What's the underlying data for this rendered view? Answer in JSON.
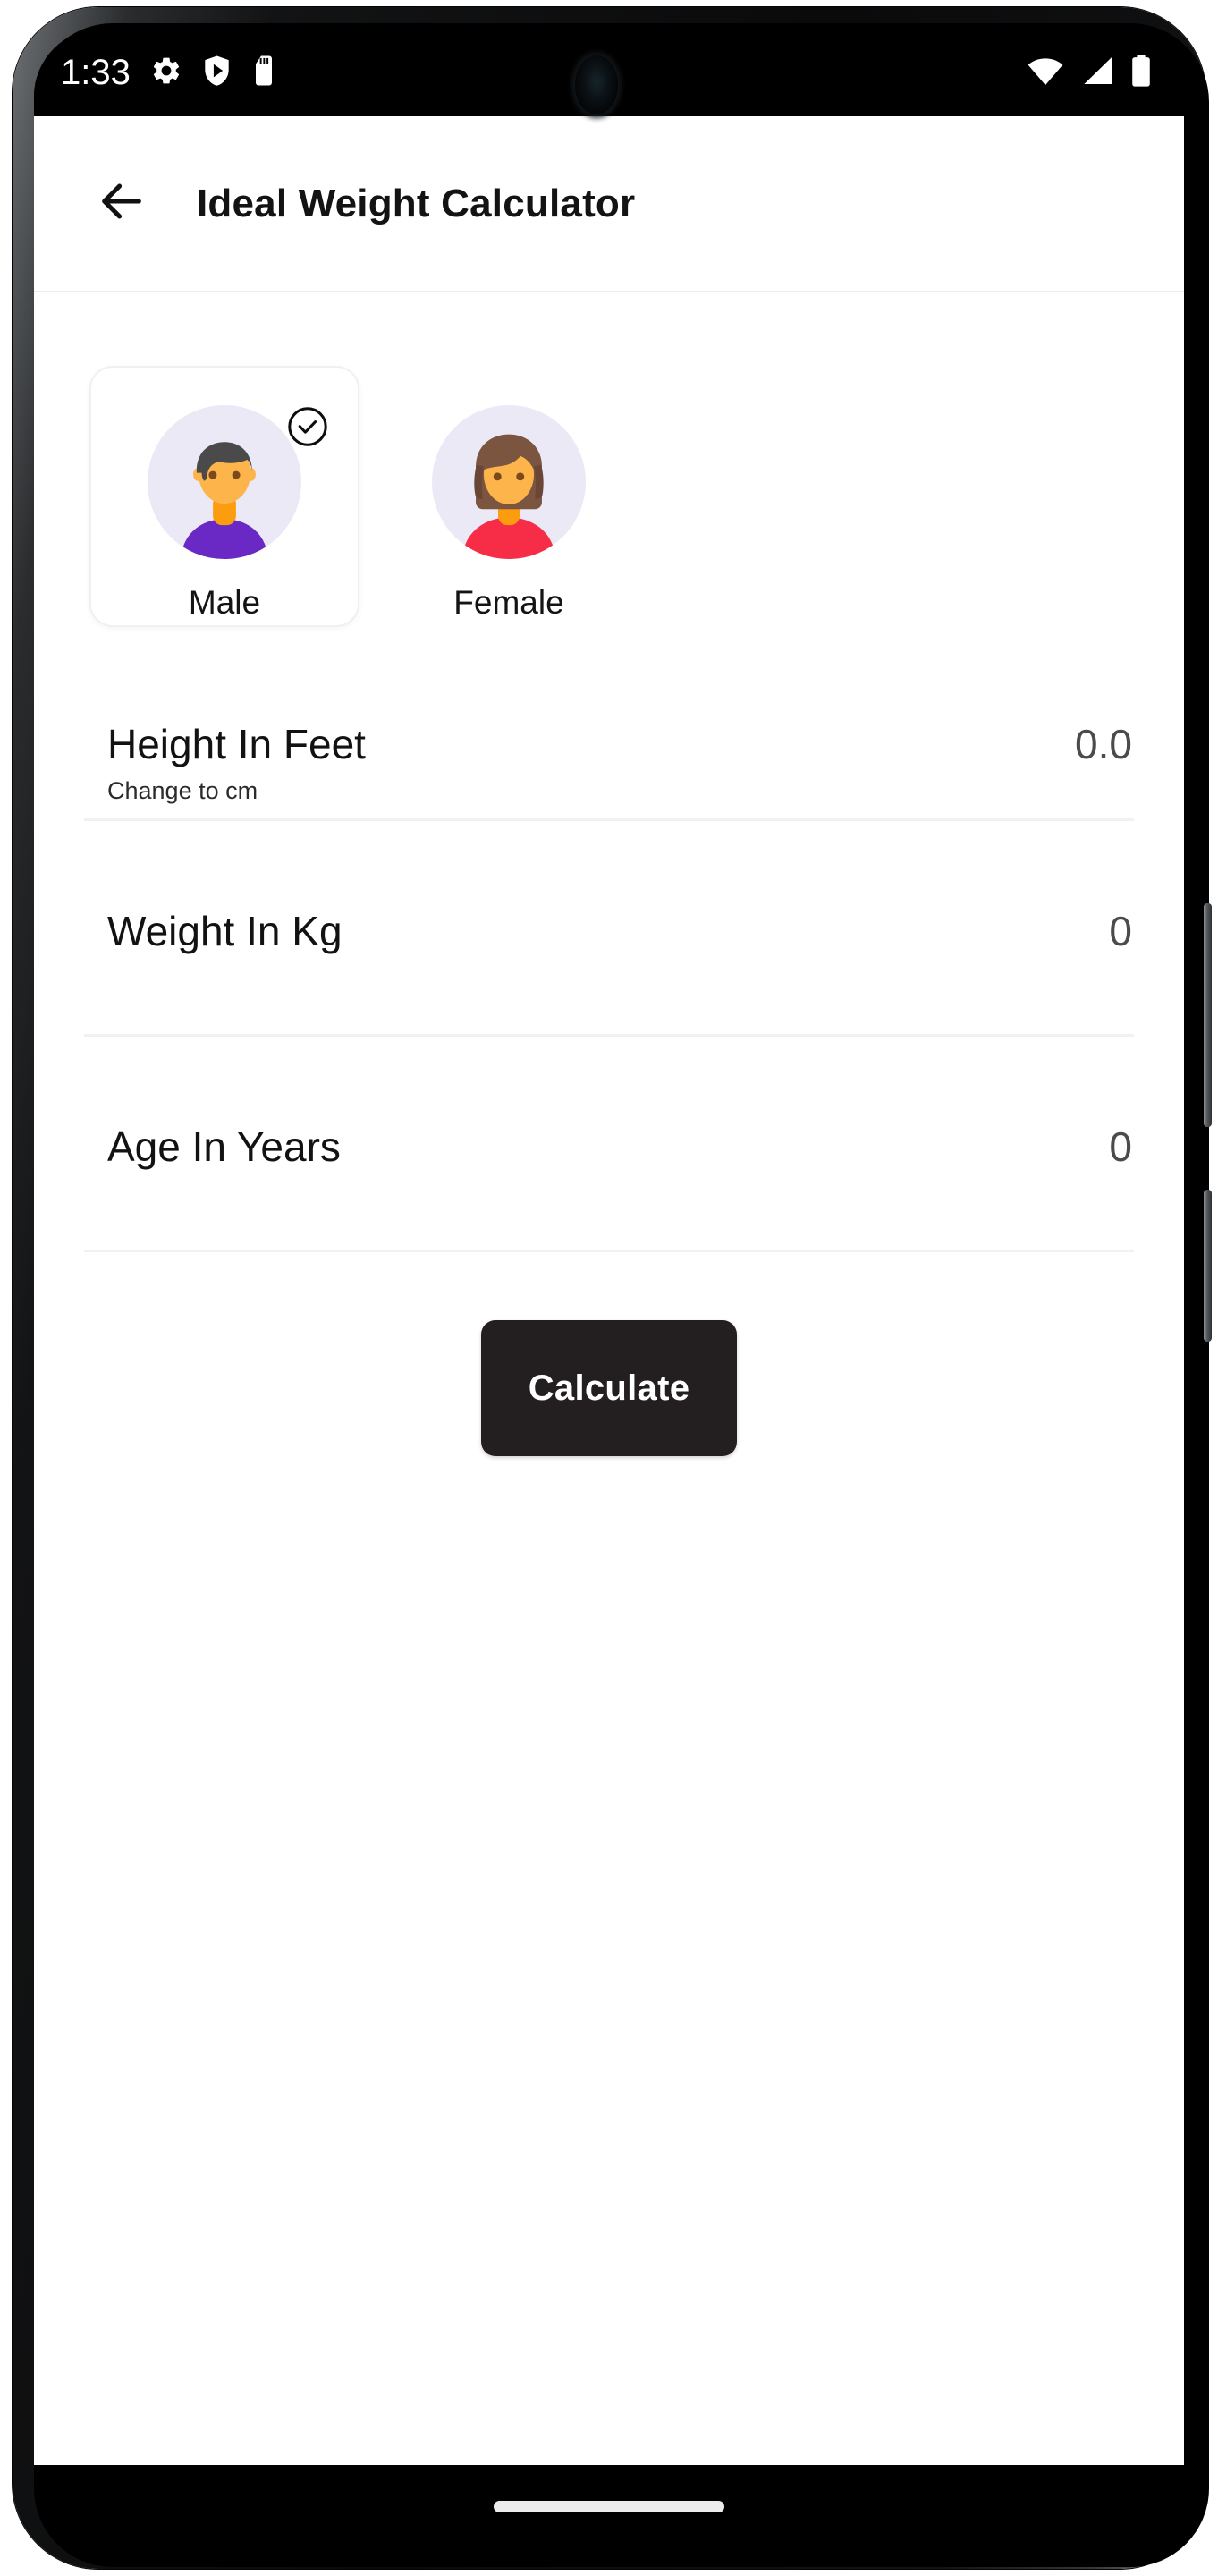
{
  "status_bar": {
    "time": "1:33",
    "left_icons": [
      "gear-icon",
      "shield-icon",
      "sd-card-icon"
    ],
    "right_icons": [
      "wifi-icon",
      "cellular-signal-icon",
      "battery-icon"
    ]
  },
  "app_bar": {
    "back_icon": "arrow-left-icon",
    "title": "Ideal Weight Calculator"
  },
  "gender": {
    "selected": "Male",
    "check_icon": "check-circle-icon",
    "options": [
      {
        "label": "Male",
        "avatar": "male-avatar-icon",
        "selected": true
      },
      {
        "label": "Female",
        "avatar": "female-avatar-icon",
        "selected": false
      }
    ]
  },
  "fields": [
    {
      "label": "Height In Feet",
      "value": "0.0",
      "sub": "Change to cm"
    },
    {
      "label": "Weight In Kg",
      "value": "0",
      "sub": ""
    },
    {
      "label": "Age In Years",
      "value": "0",
      "sub": ""
    }
  ],
  "actions": {
    "calculate_label": "Calculate"
  },
  "nav_bar": {
    "gesture_pill": "home-gesture-pill"
  },
  "colors": {
    "button_bg": "#231f20",
    "avatar_bg": "#ece9f7",
    "male_shirt": "#6a29c4",
    "female_shirt": "#f72c47",
    "skin": "#fdb44b",
    "male_hair": "#4a4a4a",
    "female_hair": "#7b5540",
    "divider": "#f1f1f1",
    "card_border": "#f0f0f0"
  }
}
